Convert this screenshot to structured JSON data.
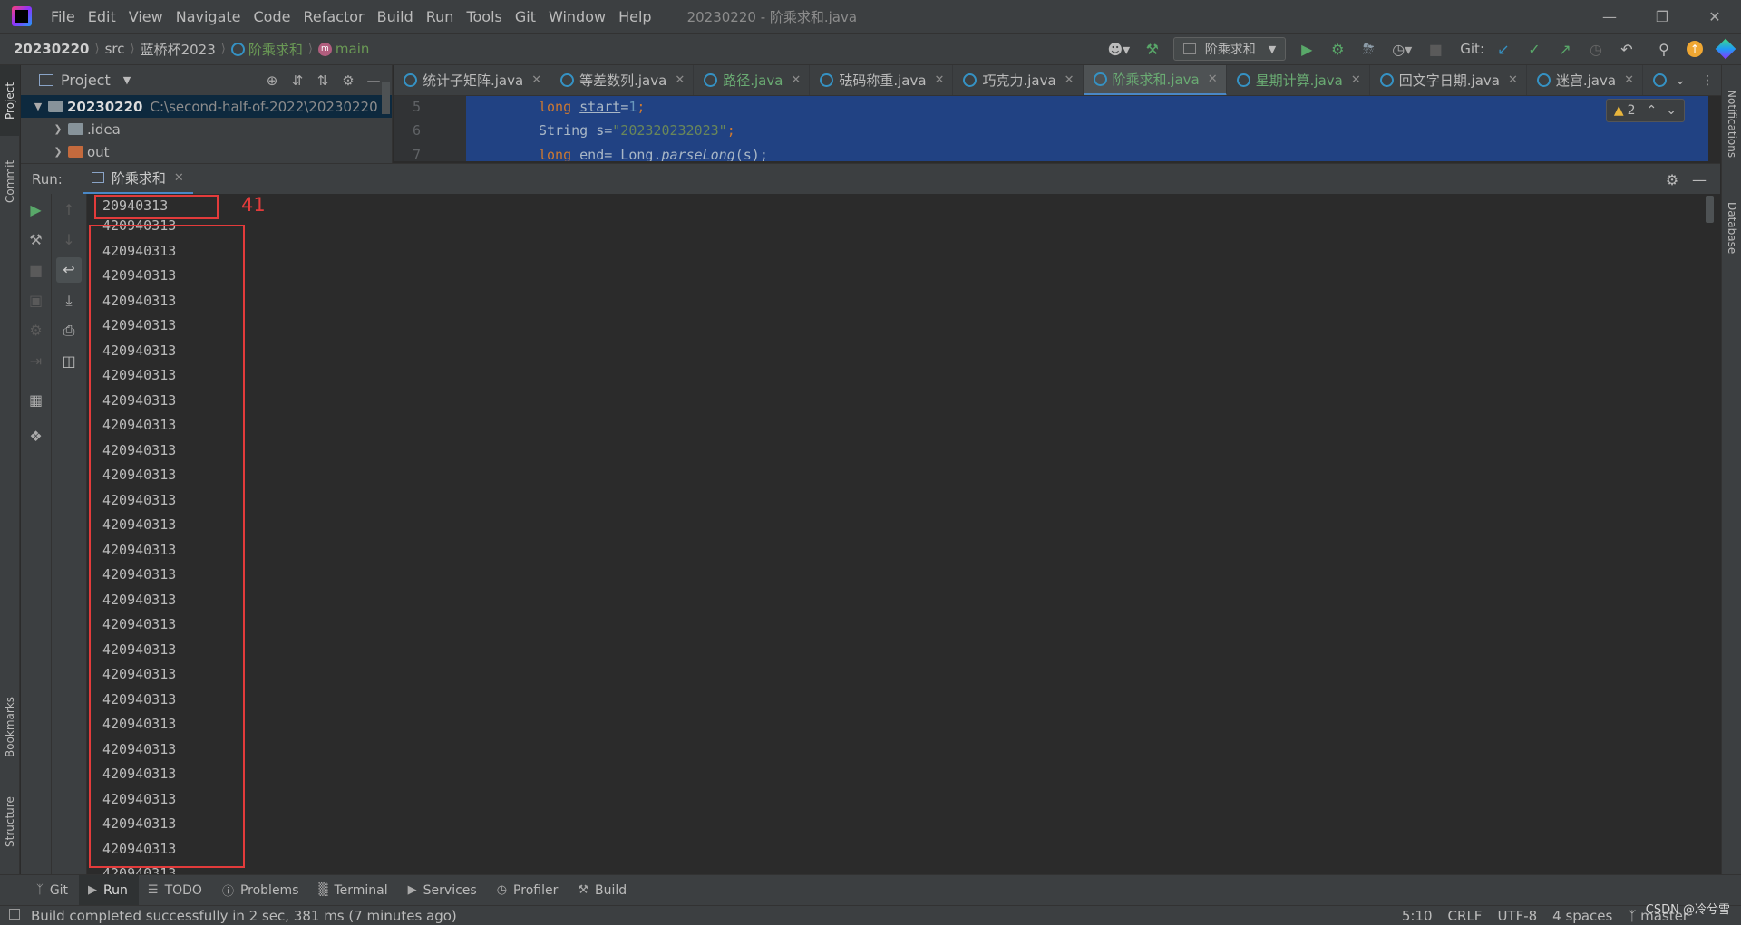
{
  "menu": [
    "File",
    "Edit",
    "View",
    "Navigate",
    "Code",
    "Refactor",
    "Build",
    "Run",
    "Tools",
    "Git",
    "Window",
    "Help"
  ],
  "window_title": "20230220 - 阶乘求和.java",
  "breadcrumbs": {
    "project": "20230220",
    "src": "src",
    "package": "蓝桥杯2023",
    "class": "阶乘求和",
    "method": "main"
  },
  "nav": {
    "run_config": "阶乘求和",
    "git_label": "Git:"
  },
  "left_tabs": {
    "project": "Project",
    "commit": "Commit",
    "bookmarks": "Bookmarks",
    "structure": "Structure"
  },
  "right_tabs": {
    "notifications": "Notifications",
    "database": "Database"
  },
  "project_panel": {
    "title": "Project",
    "tree": [
      {
        "name": "20230220",
        "path": "C:\\second-half-of-2022\\20230220"
      },
      {
        "name": ".idea"
      },
      {
        "name": "out"
      }
    ]
  },
  "editor": {
    "tabs": [
      {
        "label": "统计子矩阵.java"
      },
      {
        "label": "等差数列.java"
      },
      {
        "label": "路径.java"
      },
      {
        "label": "砝码称重.java"
      },
      {
        "label": "巧克力.java"
      },
      {
        "label": "阶乘求和.java"
      },
      {
        "label": "星期计算.java"
      },
      {
        "label": "回文字日期.java"
      },
      {
        "label": "迷宫.java"
      }
    ],
    "line_numbers": [
      "5",
      "6",
      "7"
    ],
    "code": {
      "l5_kw": "long ",
      "l5_var": "start",
      "l5_eq": "=",
      "l5_num": "1",
      "l5_end": ";",
      "l6_a": "String s=",
      "l6_str": "\"202320232023\"",
      "l6_end": ";",
      "l7_kw": "long ",
      "l7_b": "end= Long.",
      "l7_it": "parseLong",
      "l7_c": "(s);"
    },
    "warnings": "2"
  },
  "run": {
    "label": "Run:",
    "tab": "阶乘求和",
    "output_first": "20940313",
    "output_repeat": "420940313",
    "annotation": "41"
  },
  "bottom_tools": [
    "Git",
    "Run",
    "TODO",
    "Problems",
    "Terminal",
    "Services",
    "Profiler",
    "Build"
  ],
  "status": {
    "message": "Build completed successfully in 2 sec, 381 ms (7 minutes ago)",
    "position": "5:10",
    "line_sep": "CRLF",
    "encoding": "UTF-8",
    "indent": "4 spaces",
    "branch": "master",
    "watermark": "CSDN @冷兮雪"
  }
}
